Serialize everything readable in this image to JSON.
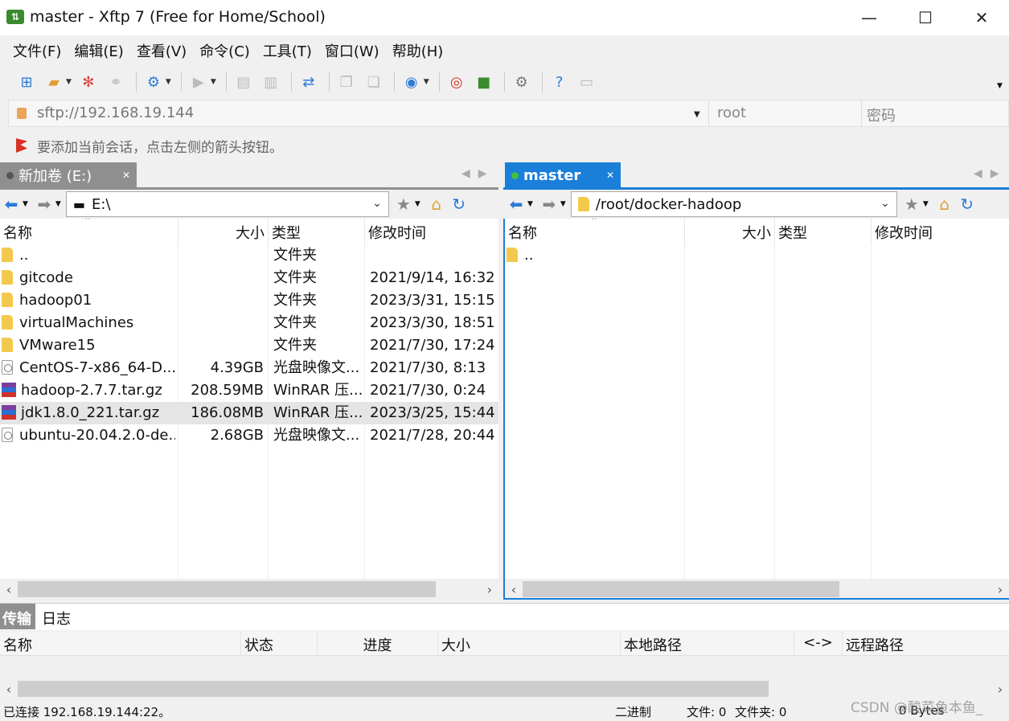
{
  "window": {
    "title": "master - Xftp 7 (Free for Home/School)"
  },
  "menu": [
    "文件(F)",
    "编辑(E)",
    "查看(V)",
    "命令(C)",
    "工具(T)",
    "窗口(W)",
    "帮助(H)"
  ],
  "address": {
    "url": "sftp://192.168.19.144",
    "user_placeholder": "root",
    "password_placeholder": "密码"
  },
  "hint": "要添加当前会话，点击左侧的箭头按钮。",
  "left": {
    "tab": "新加卷 (E:)",
    "path": "E:\\",
    "columns": [
      "名称",
      "大小",
      "类型",
      "修改时间"
    ],
    "rows": [
      {
        "name": "..",
        "size": "",
        "type": "文件夹",
        "modified": "",
        "icon": "folder"
      },
      {
        "name": "gitcode",
        "size": "",
        "type": "文件夹",
        "modified": "2021/9/14, 16:32",
        "icon": "folder"
      },
      {
        "name": "hadoop01",
        "size": "",
        "type": "文件夹",
        "modified": "2023/3/31, 15:15",
        "icon": "folder"
      },
      {
        "name": "virtualMachines",
        "size": "",
        "type": "文件夹",
        "modified": "2023/3/30, 18:51",
        "icon": "folder"
      },
      {
        "name": "VMware15",
        "size": "",
        "type": "文件夹",
        "modified": "2021/7/30, 17:24",
        "icon": "folder"
      },
      {
        "name": "CentOS-7-x86_64-D...",
        "size": "4.39GB",
        "type": "光盘映像文...",
        "modified": "2021/7/30, 8:13",
        "icon": "disc"
      },
      {
        "name": "hadoop-2.7.7.tar.gz",
        "size": "208.59MB",
        "type": "WinRAR 压...",
        "modified": "2021/7/30, 0:24",
        "icon": "rar"
      },
      {
        "name": "jdk1.8.0_221.tar.gz",
        "size": "186.08MB",
        "type": "WinRAR 压...",
        "modified": "2023/3/25, 15:44",
        "icon": "rar",
        "selected": true
      },
      {
        "name": "ubuntu-20.04.2.0-de...",
        "size": "2.68GB",
        "type": "光盘映像文...",
        "modified": "2021/7/28, 20:44",
        "icon": "disc"
      }
    ]
  },
  "right": {
    "tab": "master",
    "path": "/root/docker-hadoop",
    "columns": [
      "名称",
      "大小",
      "类型",
      "修改时间"
    ],
    "rows": [
      {
        "name": "..",
        "icon": "folder"
      }
    ]
  },
  "transfer": {
    "tabs": [
      "传输",
      "日志"
    ],
    "columns": [
      "名称",
      "状态",
      "进度",
      "大小",
      "本地路径",
      "<->",
      "远程路径"
    ]
  },
  "status": {
    "connection": "已连接 192.168.19.144:22。",
    "mode": "二进制",
    "files": "文件: 0",
    "folders": "文件夹: 0",
    "bytes": "0 Bytes"
  },
  "watermark": "CSDN @酸菜鱼本鱼_",
  "colors": {
    "accent": "#1a7fd9",
    "tab_active": "#1a7fd9",
    "tab_inactive": "#8a8a8a",
    "connected_dot": "#3fbf3f"
  }
}
